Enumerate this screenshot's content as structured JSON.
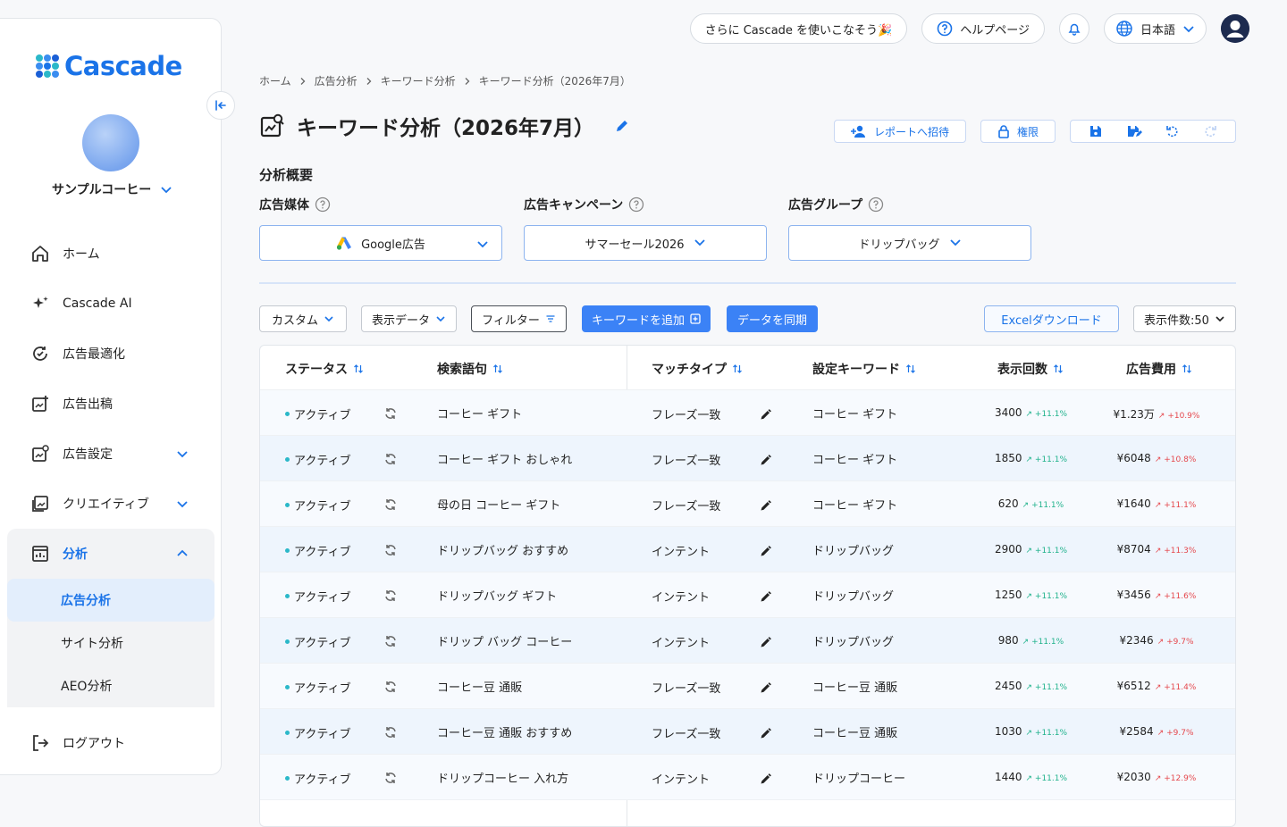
{
  "sidebar": {
    "logo_text": "Cascade",
    "account_name": "サンプルコーヒー",
    "nav": [
      {
        "label": "ホーム",
        "icon": "home-icon"
      },
      {
        "label": "Cascade AI",
        "icon": "sparkle-icon"
      },
      {
        "label": "広告最適化",
        "icon": "optimize-icon"
      },
      {
        "label": "広告出稿",
        "icon": "ad-publish-icon"
      },
      {
        "label": "広告設定",
        "icon": "ad-settings-icon"
      },
      {
        "label": "クリエイティブ",
        "icon": "image-icon"
      }
    ],
    "analysis": {
      "label": "分析",
      "children": [
        "広告分析",
        "サイト分析",
        "AEO分析"
      ]
    },
    "logout": "ログアウト"
  },
  "topbar": {
    "promo": "さらに Cascade を使いこなそう🎉",
    "help": "ヘルプページ",
    "language": "日本語"
  },
  "breadcrumb": [
    "ホーム",
    "広告分析",
    "キーワード分析",
    "キーワード分析（2026年7月）"
  ],
  "page_title": "キーワード分析（2026年7月）",
  "actions": {
    "invite": "レポートへ招待",
    "permission": "権限"
  },
  "overview": {
    "title": "分析概要",
    "media_label": "広告媒体",
    "media_value": "Google広告",
    "campaign_label": "広告キャンペーン",
    "campaign_value": "サマーセール2026",
    "group_label": "広告グループ",
    "group_value": "ドリップバッグ"
  },
  "toolbar": {
    "custom": "カスタム",
    "display_data": "表示データ",
    "filter": "フィルター",
    "add_keyword": "キーワードを追加",
    "sync": "データを同期",
    "excel": "Excelダウンロード",
    "page_size": "表示件数:50"
  },
  "table": {
    "headers": [
      "ステータス",
      "検索語句",
      "マッチタイプ",
      "設定キーワード",
      "表示回数",
      "広告費用"
    ],
    "rows": [
      {
        "status": "アクティブ",
        "term": "コーヒー ギフト",
        "match": "フレーズ一致",
        "keyword": "コーヒー ギフト",
        "impressions": "3400",
        "imp_delta": "+11.1%",
        "cost": "¥1.23万",
        "cost_delta": "+10.9%"
      },
      {
        "status": "アクティブ",
        "term": "コーヒー ギフト おしゃれ",
        "match": "フレーズ一致",
        "keyword": "コーヒー ギフト",
        "impressions": "1850",
        "imp_delta": "+11.1%",
        "cost": "¥6048",
        "cost_delta": "+10.8%"
      },
      {
        "status": "アクティブ",
        "term": "母の日 コーヒー ギフト",
        "match": "フレーズ一致",
        "keyword": "コーヒー ギフト",
        "impressions": "620",
        "imp_delta": "+11.1%",
        "cost": "¥1640",
        "cost_delta": "+11.1%"
      },
      {
        "status": "アクティブ",
        "term": "ドリップバッグ おすすめ",
        "match": "インテント",
        "keyword": "ドリップバッグ",
        "impressions": "2900",
        "imp_delta": "+11.1%",
        "cost": "¥8704",
        "cost_delta": "+11.3%"
      },
      {
        "status": "アクティブ",
        "term": "ドリップバッグ ギフト",
        "match": "インテント",
        "keyword": "ドリップバッグ",
        "impressions": "1250",
        "imp_delta": "+11.1%",
        "cost": "¥3456",
        "cost_delta": "+11.6%"
      },
      {
        "status": "アクティブ",
        "term": "ドリップ バッグ コーヒー",
        "match": "インテント",
        "keyword": "ドリップバッグ",
        "impressions": "980",
        "imp_delta": "+11.1%",
        "cost": "¥2346",
        "cost_delta": "+9.7%"
      },
      {
        "status": "アクティブ",
        "term": "コーヒー豆 通販",
        "match": "フレーズ一致",
        "keyword": "コーヒー豆 通販",
        "impressions": "2450",
        "imp_delta": "+11.1%",
        "cost": "¥6512",
        "cost_delta": "+11.4%"
      },
      {
        "status": "アクティブ",
        "term": "コーヒー豆 通販 おすすめ",
        "match": "フレーズ一致",
        "keyword": "コーヒー豆 通販",
        "impressions": "1030",
        "imp_delta": "+11.1%",
        "cost": "¥2584",
        "cost_delta": "+9.7%"
      },
      {
        "status": "アクティブ",
        "term": "ドリップコーヒー 入れ方",
        "match": "インテント",
        "keyword": "ドリップコーヒー",
        "impressions": "1440",
        "imp_delta": "+11.1%",
        "cost": "¥2030",
        "cost_delta": "+12.9%"
      }
    ]
  },
  "colors": {
    "accent": "#1a73e8",
    "button_blue": "#3b82f6",
    "up_green": "#20b28c",
    "up_red": "#e5484d",
    "status_dot": "#2bb8c9"
  }
}
